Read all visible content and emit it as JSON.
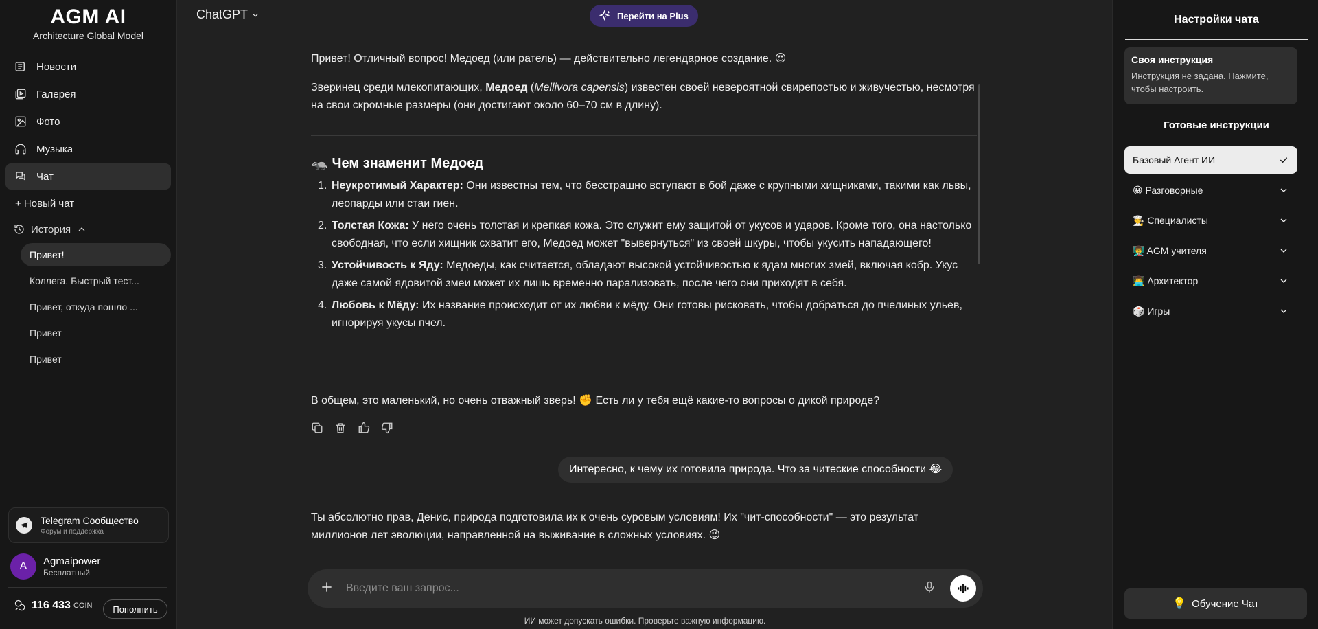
{
  "brand": {
    "title": "AGM AI",
    "subtitle": "Architecture Global Model"
  },
  "nav": [
    {
      "label": "Новости",
      "icon": "newspaper-icon"
    },
    {
      "label": "Галерея",
      "icon": "gallery-icon"
    },
    {
      "label": "Фото",
      "icon": "image-icon"
    },
    {
      "label": "Музыка",
      "icon": "headphones-icon"
    },
    {
      "label": "Чат",
      "icon": "chat-icon"
    }
  ],
  "new_chat": "+ Новый чат",
  "history": {
    "label": "История",
    "items": [
      "Привет!",
      "Коллега. Быстрый тест...",
      "Привет, откуда пошло ...",
      "Привет",
      "Привет"
    ]
  },
  "telegram": {
    "title": "Telegram Сообщество",
    "subtitle": "Форум и поддержка"
  },
  "user": {
    "initial": "A",
    "name": "Agmaipower",
    "plan": "Бесплатный"
  },
  "coins": {
    "value": "116 433",
    "unit": "COIN",
    "topup": "Пополнить"
  },
  "header": {
    "model": "ChatGPT",
    "plus": "Перейти на Plus"
  },
  "conversation": {
    "intro": "Привет! Отличный вопрос! Медоед (или ратель) — действительно легендарное создание. 😍",
    "p2_a": "Зверинец среди млекопитающих, ",
    "p2_bold": "Медоед",
    "p2_b": " (",
    "p2_italic": "Mellivora capensis",
    "p2_c": ") известен своей невероятной свирепостью и живучестью, несмотря на свои скромные размеры (они достигают около 60–70 см в длину).",
    "section_title": "🦡 Чем знаменит Медоед",
    "features": [
      {
        "num": "1.",
        "title": "Неукротимый Характер:",
        "text": " Они известны тем, что бесстрашно вступают в бой даже с крупными хищниками, такими как львы, леопарды или стаи гиен."
      },
      {
        "num": "2.",
        "title": "Толстая Кожа:",
        "text": " У него очень толстая и крепкая кожа. Это служит ему защитой от укусов и ударов. Кроме того, она настолько свободная, что если хищник схватит его, Медоед может \"вывернуться\" из своей шкуры, чтобы укусить нападающего!"
      },
      {
        "num": "3.",
        "title": "Устойчивость к Яду:",
        "text": " Медоеды, как считается, обладают высокой устойчивостью к ядам многих змей, включая кобр. Укус даже самой ядовитой змеи может их лишь временно парализовать, после чего они приходят в себя."
      },
      {
        "num": "4.",
        "title": "Любовь к Мёду:",
        "text": " Их название происходит от их любви к мёду. Они готовы рисковать, чтобы добраться до пчелиных ульев, игнорируя укусы пчел."
      }
    ],
    "outro": "В общем, это маленький, но очень отважный зверь! ✊ Есть ли у тебя ещё какие-то вопросы о дикой природе?",
    "user_message": "Интересно, к чему их готовила природа. Что за читеские способности 😂",
    "reply": "Ты абсолютно прав, Денис, природа подготовила их к очень суровым условиям! Их \"чит-способности\" — это результат миллионов лет эволюции, направленной на выживание в сложных условиях. 😉"
  },
  "composer": {
    "placeholder": "Введите ваш запрос..."
  },
  "disclaimer": "ИИ может допускать ошибки. Проверьте важную информацию.",
  "right_panel": {
    "title": "Настройки чата",
    "own_title": "Своя инструкция",
    "own_desc": "Инструкция не задана. Нажмите, чтобы настроить.",
    "ready_title": "Готовые инструкции",
    "presets": [
      {
        "label": "Базовый Агент ИИ",
        "selected": true
      },
      {
        "label": "😀 Разговорные"
      },
      {
        "label": "🧑‍🍳 Специалисты"
      },
      {
        "label": "👨‍🏫 AGM учителя"
      },
      {
        "label": "👨‍💻 Архитектор"
      },
      {
        "label": "🎲 Игры"
      }
    ],
    "learn_button": "Обучение Чат",
    "learn_icon": "💡"
  },
  "colors": {
    "background": "#212121",
    "sidebar": "#171717",
    "plus_button": "#3b2d6e",
    "avatar": "#6b21a8"
  }
}
